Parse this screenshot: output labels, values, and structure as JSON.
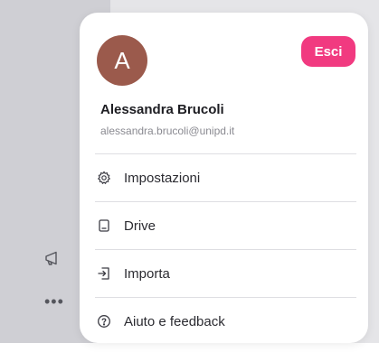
{
  "sidebar": {
    "icons": [
      {
        "name": "megaphone-icon"
      },
      {
        "name": "more-icon",
        "glyph": "•••"
      }
    ]
  },
  "account": {
    "avatar_letter": "A",
    "avatar_color": "#9b5a4c",
    "logout_label": "Esci",
    "logout_color": "#f13a80",
    "name": "Alessandra Brucoli",
    "email": "alessandra.brucoli@unipd.it"
  },
  "menu": [
    {
      "label": "Impostazioni",
      "icon": "gear-icon"
    },
    {
      "label": "Drive",
      "icon": "drive-icon"
    },
    {
      "label": "Importa",
      "icon": "import-icon"
    },
    {
      "label": "Aiuto e feedback",
      "icon": "help-icon"
    }
  ]
}
